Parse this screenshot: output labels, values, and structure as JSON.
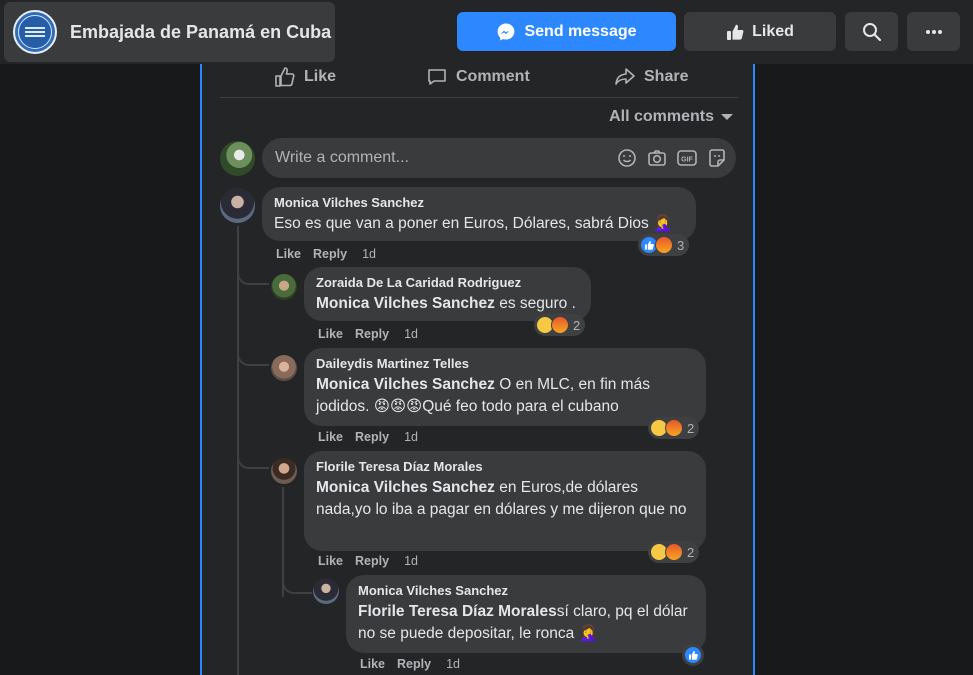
{
  "page": {
    "name": "Embajada de Panamá en Cuba",
    "send_message": "Send message",
    "liked": "Liked"
  },
  "post_actions": {
    "like": "Like",
    "comment": "Comment",
    "share": "Share"
  },
  "comments_filter": "All comments",
  "composer": {
    "placeholder": "Write a comment..."
  },
  "comments": [
    {
      "author": "Monica Vilches Sanchez",
      "text": "Eso es que van a poner en Euros, Dólares, sabrá Dios 🤦‍♀️",
      "like": "Like",
      "reply": "Reply",
      "time": "1d",
      "reactions": [
        "like",
        "angry"
      ],
      "reaction_count": "3",
      "replies": [
        {
          "author": "Zoraida De La Caridad Rodriguez",
          "mention": "Monica Vilches Sanchez",
          "text": " es seguro .",
          "like": "Like",
          "reply": "Reply",
          "time": "1d",
          "reactions": [
            "sad",
            "angry"
          ],
          "reaction_count": "2"
        },
        {
          "author": "Daileydis Martinez Telles",
          "mention": "Monica Vilches Sanchez",
          "text": " O en MLC, en fin más jodidos. 😡😡😡Qué feo todo para el cubano",
          "like": "Like",
          "reply": "Reply",
          "time": "1d",
          "reactions": [
            "sad",
            "angry"
          ],
          "reaction_count": "2"
        },
        {
          "author": "Florile Teresa Díaz Morales",
          "mention": "Monica Vilches Sanchez",
          "text": " en Euros,de dólares nada,yo lo iba a pagar en dólares y me dijeron que no",
          "like": "Like",
          "reply": "Reply",
          "time": "1d",
          "reactions": [
            "sad",
            "angry"
          ],
          "reaction_count": "2",
          "replies": [
            {
              "author": "Monica Vilches Sanchez",
              "mention": "Florile Teresa Díaz Morales",
              "text": "sí claro, pq el dólar no se puede depositar, le ronca 🤦‍♀️",
              "like": "Like",
              "reply": "Reply",
              "time": "1d",
              "reactions": [
                "like"
              ]
            }
          ]
        }
      ]
    }
  ],
  "colors": {
    "background": "#18191a",
    "card": "#242526",
    "bubble": "#3a3b3c",
    "accent": "#2d88ff",
    "text": "#e4e6eb",
    "secondary_text": "#b0b3b8"
  }
}
